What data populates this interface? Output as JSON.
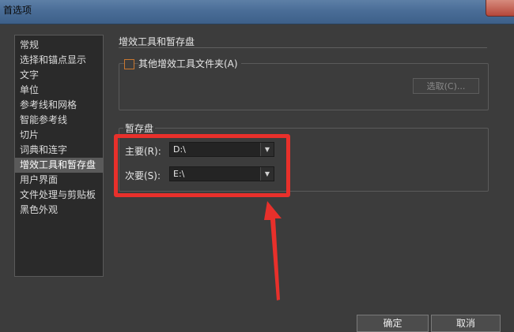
{
  "window": {
    "title": "首选项"
  },
  "sidebar": {
    "items": [
      {
        "label": "常规"
      },
      {
        "label": "选择和锚点显示"
      },
      {
        "label": "文字"
      },
      {
        "label": "单位"
      },
      {
        "label": "参考线和网格"
      },
      {
        "label": "智能参考线"
      },
      {
        "label": "切片"
      },
      {
        "label": "词典和连字"
      },
      {
        "label": "增效工具和暂存盘",
        "selected": true
      },
      {
        "label": "用户界面"
      },
      {
        "label": "文件处理与剪贴板"
      },
      {
        "label": "黑色外观"
      }
    ]
  },
  "main": {
    "section_title": "增效工具和暂存盘",
    "plugins": {
      "checkbox_label": "其他增效工具文件夹(A)",
      "checked": false,
      "browse_button": "选取(C)..."
    },
    "scratch": {
      "group_label": "暂存盘",
      "primary_label": "主要(R):",
      "primary_value": "D:\\",
      "secondary_label": "次要(S):",
      "secondary_value": "E:\\"
    }
  },
  "footer": {
    "ok_label": "确定",
    "cancel_label": "取消"
  },
  "colors": {
    "annotation": "#e8302b",
    "checkbox_border": "#c9772f",
    "selected_bg": "#5a5a5a"
  },
  "icons": {
    "dropdown": "chevron-down-icon",
    "annotation_arrow": "red-arrow-icon"
  }
}
